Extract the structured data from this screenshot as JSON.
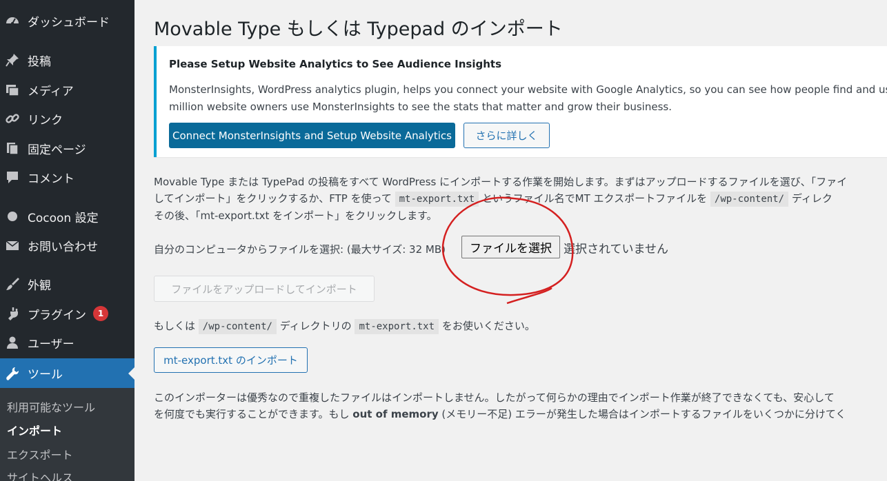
{
  "sidebar": {
    "items": [
      {
        "label": "ダッシュボード",
        "icon": "dashboard-icon"
      },
      {
        "label": "投稿",
        "icon": "pin-icon"
      },
      {
        "label": "メディア",
        "icon": "media-icon"
      },
      {
        "label": "リンク",
        "icon": "link-icon"
      },
      {
        "label": "固定ページ",
        "icon": "pages-icon"
      },
      {
        "label": "コメント",
        "icon": "comment-icon"
      },
      {
        "label": "Cocoon 設定",
        "icon": "circle-icon"
      },
      {
        "label": "お問い合わせ",
        "icon": "mail-icon"
      },
      {
        "label": "外観",
        "icon": "brush-icon"
      },
      {
        "label": "プラグイン",
        "icon": "plugin-icon",
        "badge": "1"
      },
      {
        "label": "ユーザー",
        "icon": "user-icon"
      },
      {
        "label": "ツール",
        "icon": "wrench-icon",
        "current": true
      }
    ],
    "submenu": [
      {
        "label": "利用可能なツール"
      },
      {
        "label": "インポート",
        "current": true
      },
      {
        "label": "エクスポート"
      },
      {
        "label": "サイトヘルス"
      }
    ]
  },
  "page": {
    "title": "Movable Type もしくは Typepad のインポート"
  },
  "notice": {
    "title": "Please Setup Website Analytics to See Audience Insights",
    "line1": "MonsterInsights, WordPress analytics plugin, helps you connect your website with Google Analytics, so you can see how people find and use your",
    "line2": "million website owners use MonsterInsights to see the stats that matter and grow their business.",
    "primary_button": "Connect MonsterInsights and Setup Website Analytics",
    "secondary_button": "さらに詳しく"
  },
  "intro": {
    "line1": "Movable Type または TypePad の投稿をすべて WordPress にインポートする作業を開始します。まずはアップロードするファイルを選び、「ファイ",
    "line2_a": "してインポート」をクリックするか、FTP を使って",
    "line2_code1": "mt-export.txt",
    "line2_b": "というファイル名でMT エクスポートファイルを",
    "line2_code2": "/wp-content/",
    "line2_c": "ディレク",
    "line3": "その後、「mt-export.txt をインポート」をクリックします。"
  },
  "upload": {
    "label": "自分のコンピュータからファイルを選択: (最大サイズ: 32 MB)",
    "file_button": "ファイルを選択",
    "file_status": "選択されていません",
    "submit_button": "ファイルをアップロードしてインポート"
  },
  "alt": {
    "text_a": "もしくは",
    "code1": "/wp-content/",
    "text_b": "ディレクトリの",
    "code2": "mt-export.txt",
    "text_c": "をお使いください。",
    "button": "mt-export.txt のインポート"
  },
  "footer": {
    "line1": "このインポーターは優秀なので重複したファイルはインポートしません。したがって何らかの理由でインポート作業が終了できなくても、安心して",
    "line2_a": "を何度でも実行することができます。もし",
    "line2_bold": "out of memory",
    "line2_b": "(メモリー不足) エラーが発生した場合はインポートするファイルをいくつかに分けてく"
  },
  "colors": {
    "sidebar_bg": "#23282d",
    "accent": "#2271b1",
    "notice_border": "#00a0d2",
    "annotation": "#d42020"
  }
}
